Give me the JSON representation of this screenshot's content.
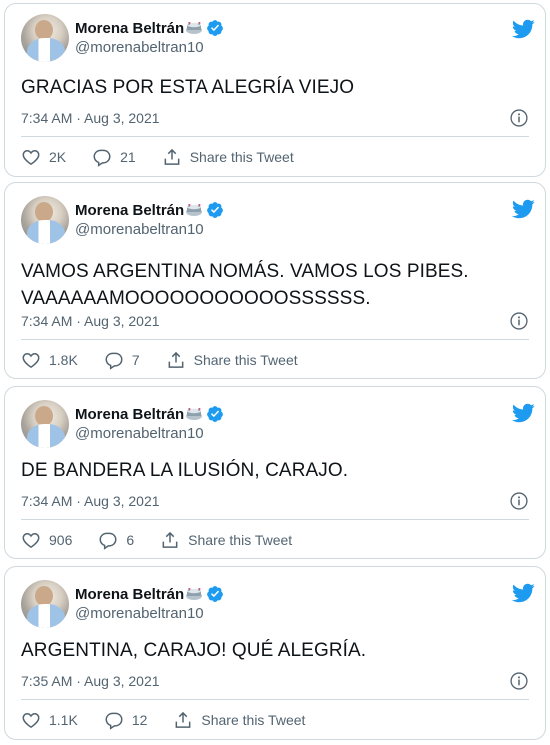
{
  "colors": {
    "twitter_blue": "#1d9bf0",
    "text": "#0f1419",
    "secondary": "#536471",
    "border": "#cfd9de"
  },
  "icons": {
    "bird": "twitter-bird-icon",
    "verified": "verified-badge-icon",
    "stadium": "stadium-emoji-icon",
    "info": "info-icon",
    "like": "heart-icon",
    "reply": "reply-bubble-icon",
    "share": "share-icon"
  },
  "tweets": [
    {
      "display_name": "Morena Beltrán",
      "handle": "@morenabeltran10",
      "text_lines": [
        "GRACIAS POR ESTA ALEGRÍA VIEJO"
      ],
      "timestamp": "7:34 AM · Aug 3, 2021",
      "likes": "2K",
      "replies": "21",
      "share_label": "Share this Tweet"
    },
    {
      "display_name": "Morena Beltrán",
      "handle": "@morenabeltran10",
      "text_lines": [
        "VAMOS ARGENTINA NOMÁS. VAMOS LOS PIBES.",
        "VAAAAAAMOOOOOOOOOOOSSSSSS."
      ],
      "timestamp": "7:34 AM · Aug 3, 2021",
      "likes": "1.8K",
      "replies": "7",
      "share_label": "Share this Tweet"
    },
    {
      "display_name": "Morena Beltrán",
      "handle": "@morenabeltran10",
      "text_lines": [
        "DE BANDERA LA ILUSIÓN, CARAJO."
      ],
      "timestamp": "7:34 AM · Aug 3, 2021",
      "likes": "906",
      "replies": "6",
      "share_label": "Share this Tweet"
    },
    {
      "display_name": "Morena Beltrán",
      "handle": "@morenabeltran10",
      "text_lines": [
        "ARGENTINA, CARAJO! QUÉ ALEGRÍA."
      ],
      "timestamp": "7:35 AM · Aug 3, 2021",
      "likes": "1.1K",
      "replies": "12",
      "share_label": "Share this Tweet"
    }
  ]
}
